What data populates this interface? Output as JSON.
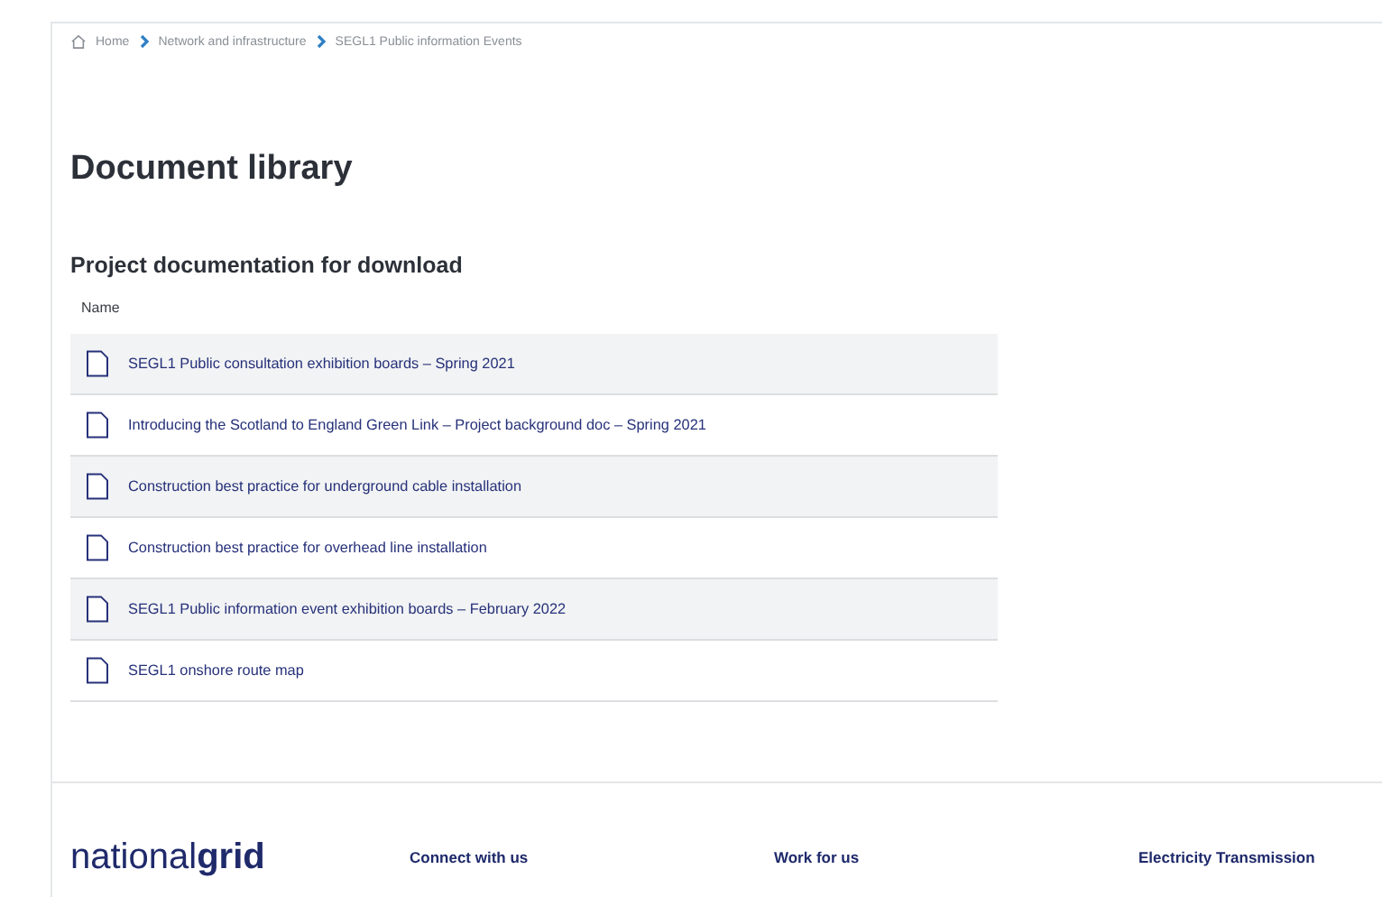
{
  "breadcrumb": [
    {
      "label": "Home"
    },
    {
      "label": "Network and infrastructure"
    },
    {
      "label": "SEGL1 Public information Events"
    }
  ],
  "title": "Document library",
  "section": {
    "heading": "Project documentation for download",
    "column": "Name",
    "documents": [
      {
        "name": "SEGL1 Public consultation exhibition boards – Spring 2021"
      },
      {
        "name": "Introducing the Scotland to England Green Link – Project background doc – Spring 2021"
      },
      {
        "name": "Construction best practice for underground cable installation"
      },
      {
        "name": "Construction best practice for overhead line installation"
      },
      {
        "name": "SEGL1 Public information event exhibition boards – February 2022"
      },
      {
        "name": "SEGL1 onshore route map"
      }
    ]
  },
  "footer": {
    "logo": "national**grid**",
    "columns": [
      "Connect with us",
      "Work for us",
      "Electricity Transmission"
    ]
  }
}
